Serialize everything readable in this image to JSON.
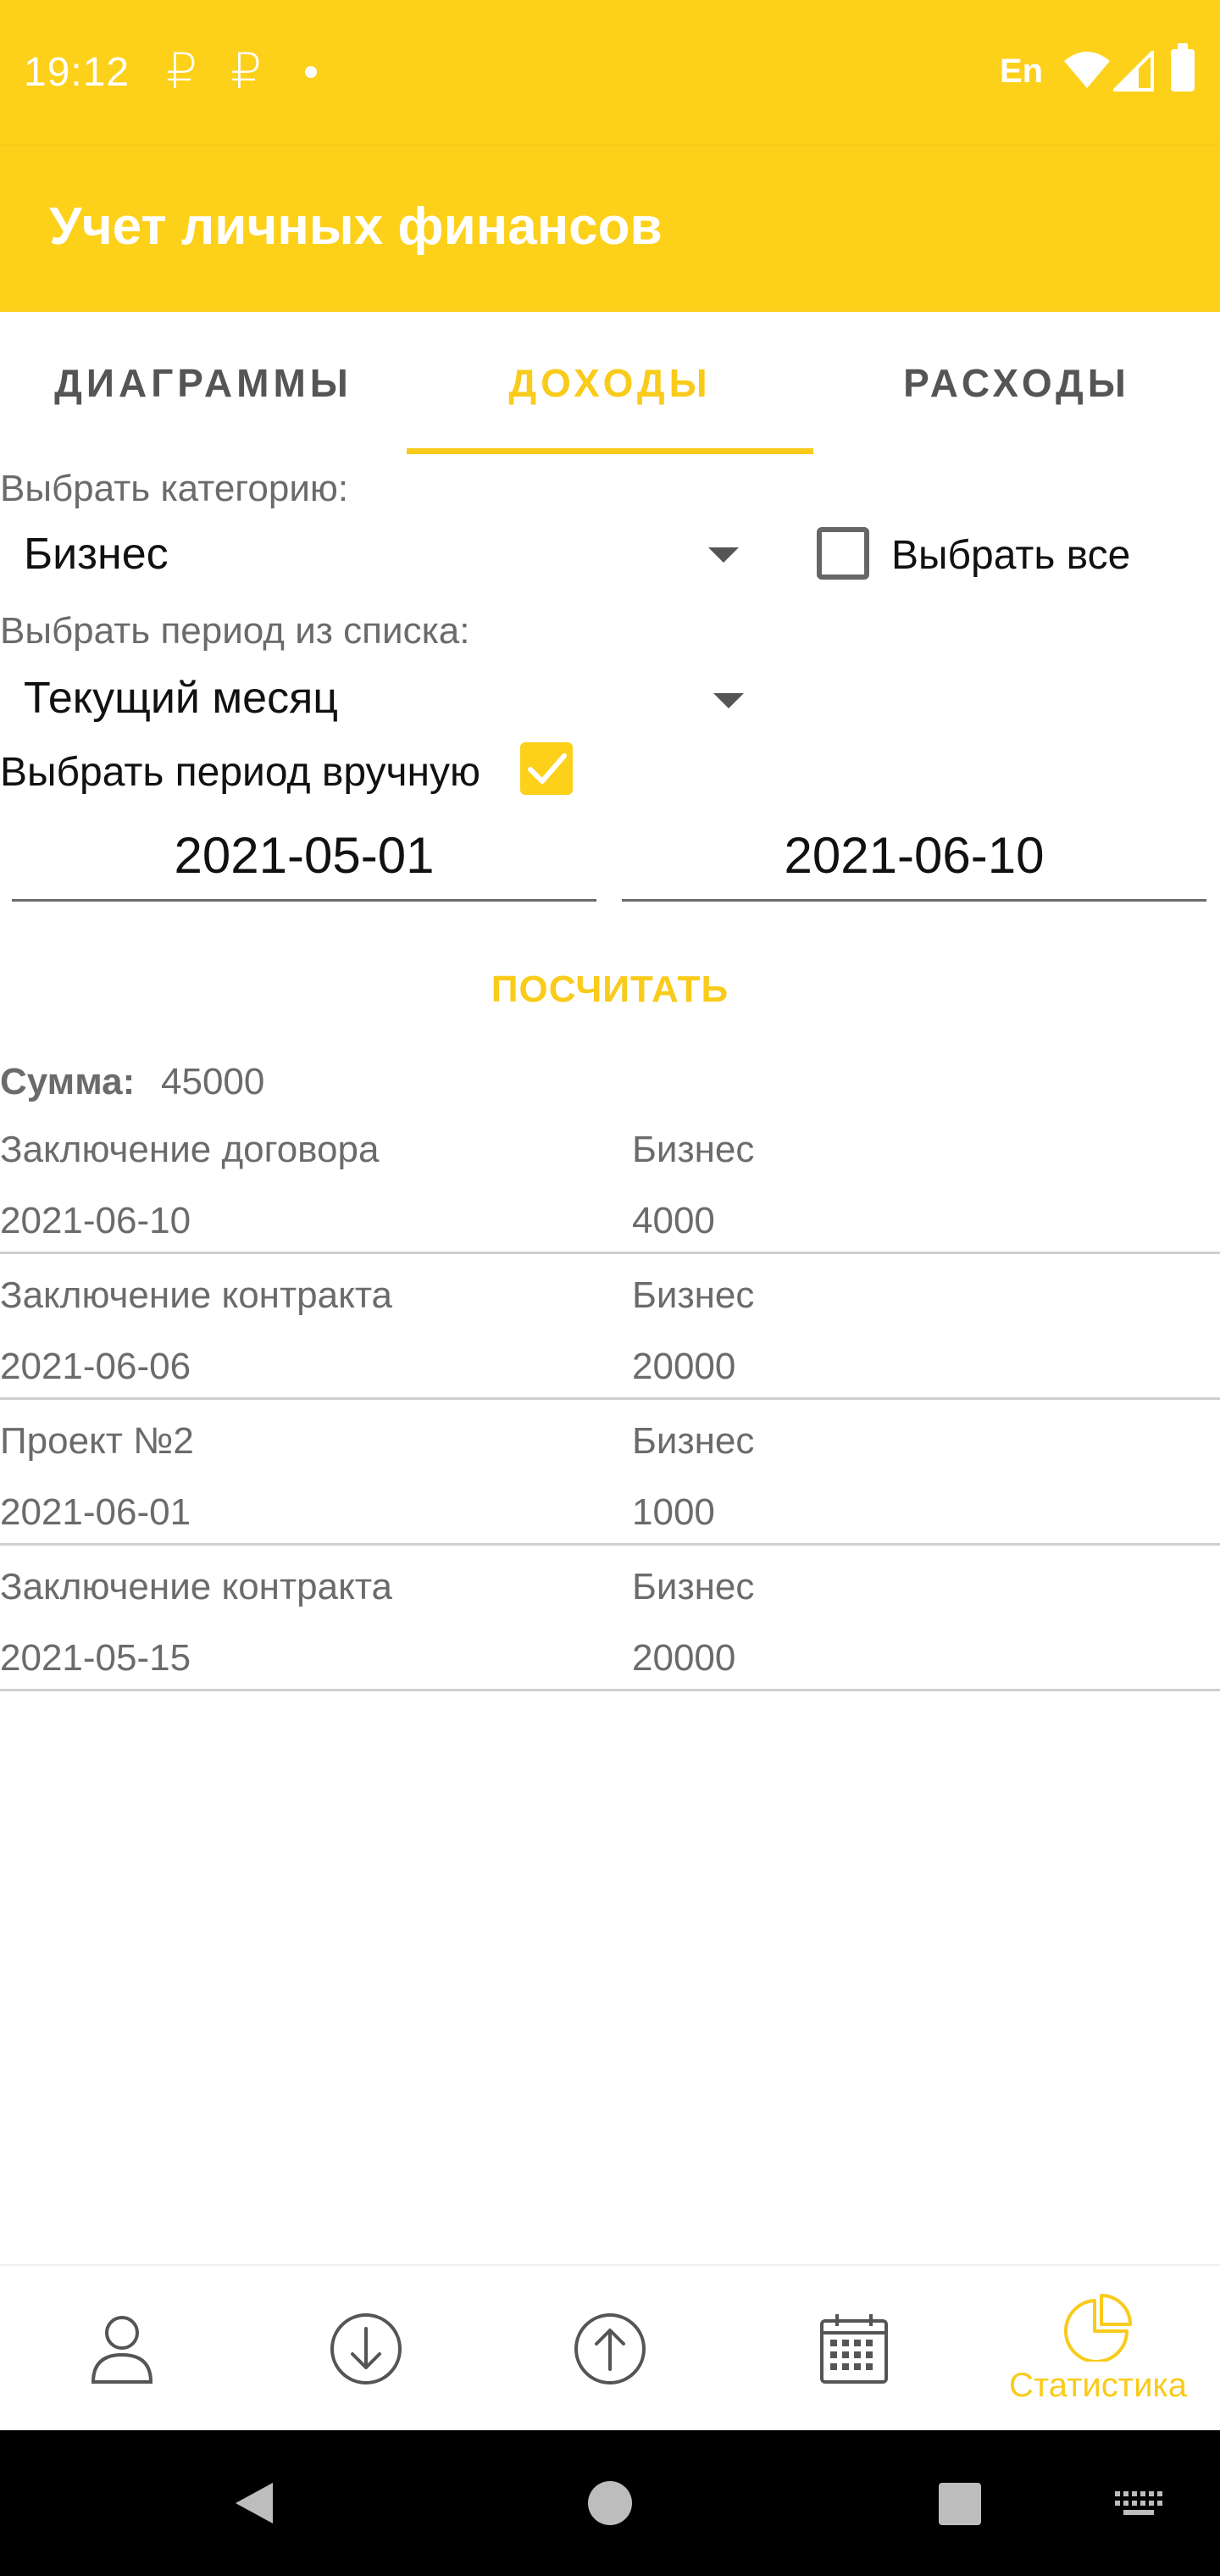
{
  "status_bar": {
    "time": "19:12",
    "currency_glyph": "₽",
    "language": "En"
  },
  "app_bar": {
    "title": "Учет личных финансов"
  },
  "tabs": [
    {
      "label": "ДИАГРАММЫ",
      "active": false
    },
    {
      "label": "ДОХОДЫ",
      "active": true
    },
    {
      "label": "РАСХОДЫ",
      "active": false
    }
  ],
  "filters": {
    "category_label": "Выбрать категорию:",
    "category_value": "Бизнес",
    "select_all_label": "Выбрать все",
    "select_all_checked": false,
    "period_label": "Выбрать период из списка:",
    "period_value": "Текущий месяц",
    "manual_period_label": "Выбрать период вручную",
    "manual_period_checked": true,
    "date_from": "2021-05-01",
    "date_to": "2021-06-10"
  },
  "calculate_button": "ПОСЧИТАТЬ",
  "summary": {
    "label": "Сумма:",
    "value": "45000"
  },
  "records": [
    {
      "title": "Заключение договора",
      "date": "2021-06-10",
      "category": "Бизнес",
      "amount": "4000"
    },
    {
      "title": "Заключение контракта",
      "date": "2021-06-06",
      "category": "Бизнес",
      "amount": "20000"
    },
    {
      "title": "Проект №2",
      "date": "2021-06-01",
      "category": "Бизнес",
      "amount": "1000"
    },
    {
      "title": "Заключение контракта",
      "date": "2021-05-15",
      "category": "Бизнес",
      "amount": "20000"
    }
  ],
  "bottom_nav": {
    "items": [
      {
        "icon": "person-icon"
      },
      {
        "icon": "arrow-down-circle-icon"
      },
      {
        "icon": "arrow-up-circle-icon"
      },
      {
        "icon": "calendar-icon"
      },
      {
        "icon": "pie-chart-icon",
        "label": "Статистика",
        "active": true
      }
    ]
  },
  "colors": {
    "accent": "#fdd01a",
    "accent_text": "#f9cb1a",
    "secondary_text": "#6b6b6b"
  }
}
